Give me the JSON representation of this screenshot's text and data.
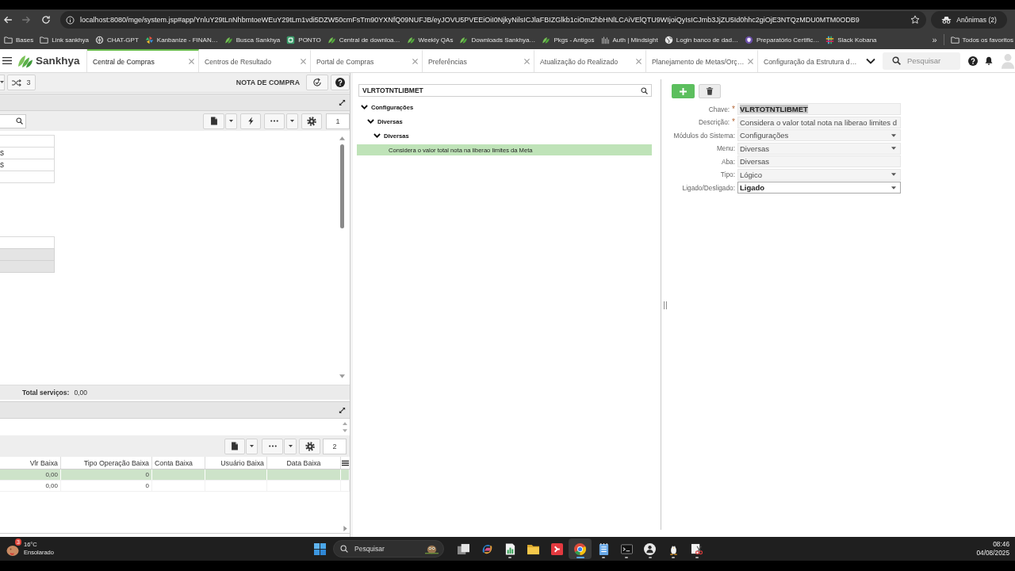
{
  "browser": {
    "back": {
      "disabled": false
    },
    "forward": {
      "disabled": true
    },
    "url": "localhost:8080/mge/system.jsp#app/YnluY29tLnNhbmtoeWEuY29tLm1vdi5DZW50cmFsTm90YXNfQ09NUFJB/eyJOVU5PVEEiOiI0NjkyNilsICJlaFBIZGlkb1ciOmZhbHNlLCAiVElQTU9WIjoiQyIsICJmb3JjZU5Id0hhc2giOjE3NTQzMDU0MTM0ODB9",
    "profile": "Anônimas (2)"
  },
  "bookmarks": {
    "items": [
      {
        "label": "Bases",
        "kind": "folder"
      },
      {
        "label": "Link sankhya",
        "kind": "folder"
      },
      {
        "label": "CHAT-GPT",
        "kind": "chat"
      },
      {
        "label": "Kanbanize - FINAN…",
        "kind": "kanban"
      },
      {
        "label": "Busca Sankhya",
        "kind": "leaf"
      },
      {
        "label": "PONTO",
        "kind": "ponto"
      },
      {
        "label": "Central de downloa…",
        "kind": "leaf"
      },
      {
        "label": "Weekly QAs",
        "kind": "leaf"
      },
      {
        "label": "Downloads Sankhya…",
        "kind": "leaf"
      },
      {
        "label": "Pkgs - Antigos",
        "kind": "leaf"
      },
      {
        "label": "Auth | Mindsight",
        "kind": "bars"
      },
      {
        "label": "Login banco de dad…",
        "kind": "globe"
      },
      {
        "label": "Preparatório Certific…",
        "kind": "cert"
      },
      {
        "label": "Slack Kobana",
        "kind": "slack"
      }
    ],
    "overflow": "»",
    "all_folder": "Todos os favoritos"
  },
  "app": {
    "brand": "Sankhya",
    "tabs": [
      {
        "label": "Central de Compras",
        "selected": true,
        "closable": true
      },
      {
        "label": "Centros de Resultado",
        "selected": false,
        "closable": true
      },
      {
        "label": "Portal de Compras",
        "selected": false,
        "closable": true
      },
      {
        "label": "Preferências",
        "selected": false,
        "closable": true
      },
      {
        "label": "Atualização do Realizado",
        "selected": false,
        "closable": true
      },
      {
        "label": "Planejamento de Metas/Orç…",
        "selected": false,
        "closable": true
      },
      {
        "label": "Configuração da Estrutura d…",
        "selected": false,
        "closable": false
      }
    ],
    "search": {
      "placeholder": "Pesquisar"
    }
  },
  "left_panel": {
    "toolbar": {
      "count": "3",
      "title": "NOTA DE COMPRA"
    },
    "grid_toolbar": {
      "page": "1"
    },
    "fields_top": [
      {
        "disabled": false
      },
      {
        "value": "s",
        "disabled": false
      },
      {
        "value": "s",
        "disabled": false
      },
      {
        "disabled": false
      }
    ],
    "fields_bottom": [
      {
        "disabled": false
      },
      {
        "disabled": true
      },
      {
        "disabled": true
      }
    ],
    "total": {
      "label": "Total serviços:",
      "value": "0,00"
    },
    "detail_toolbar": {
      "page": "2"
    },
    "table": {
      "columns": [
        "Vlr Baixa",
        "Tipo Operação Baixa",
        "Conta Baixa",
        "Usuário Baixa",
        "Data Baixa"
      ],
      "rows": [
        {
          "vlr_baixa": "0,00",
          "tipo_operacao_baixa": "0",
          "selected": true
        },
        {
          "vlr_baixa": "0,00",
          "tipo_operacao_baixa": "0",
          "selected": false
        }
      ]
    }
  },
  "middle_panel": {
    "search": {
      "value": "VLRTOTNTLIBMET"
    },
    "tree": [
      {
        "label": "Configurações",
        "expanded": true,
        "selected": false,
        "children": [
          {
            "label": "Diversas",
            "expanded": true,
            "selected": false,
            "children": [
              {
                "label": "Diversas",
                "expanded": true,
                "selected": false,
                "children": [
                  {
                    "label": "Considera o valor total nota na liberao limites da Meta",
                    "selected": true
                  }
                ]
              }
            ]
          }
        ]
      }
    ]
  },
  "right_panel": {
    "fields": [
      {
        "label": "Chave:",
        "required_mark": "*",
        "value": "VLRTOTNTLIBMET",
        "kind": "text",
        "disabled": true,
        "text_selected": true
      },
      {
        "label": "Descrição:",
        "required_mark": "*",
        "value": "Considera o valor total nota na liberao limites d",
        "kind": "text",
        "disabled": true,
        "text_selected": false
      },
      {
        "label": "Módulos do Sistema:",
        "value": "Configurações",
        "kind": "select",
        "disabled": true,
        "text_selected": false
      },
      {
        "label": "Menu:",
        "value": "Diversas",
        "kind": "select",
        "disabled": true,
        "text_selected": false
      },
      {
        "label": "Aba:",
        "value": "Diversas",
        "kind": "text",
        "disabled": true,
        "text_selected": false
      },
      {
        "label": "Tipo:",
        "value": "Lógico",
        "kind": "select",
        "disabled": true,
        "text_selected": false
      },
      {
        "label": "Ligado/Desligado:",
        "value": "Ligado",
        "kind": "select",
        "disabled": false,
        "text_selected": false
      }
    ]
  },
  "taskbar": {
    "weather": {
      "badge": "3",
      "temperature": "16°C",
      "condition": "Ensolarado"
    },
    "search": {
      "placeholder": "Pesquisar"
    },
    "apps": [
      {
        "kind": "taskview",
        "running": false,
        "active": false
      },
      {
        "kind": "swirl",
        "running": false,
        "active": false
      },
      {
        "kind": "sheet",
        "running": true,
        "active": false
      },
      {
        "kind": "folder",
        "running": false,
        "active": false
      },
      {
        "kind": "arrow",
        "running": false,
        "active": false
      },
      {
        "kind": "browser",
        "running": true,
        "active": true
      },
      {
        "kind": "notepad",
        "running": true,
        "active": false
      },
      {
        "kind": "terminal",
        "running": true,
        "active": false
      },
      {
        "kind": "face",
        "running": true,
        "active": false
      },
      {
        "kind": "penguin",
        "running": true,
        "active": false
      },
      {
        "kind": "snip",
        "running": true,
        "active": false
      }
    ],
    "clock": {
      "time": "08:46",
      "date": "04/08/2025"
    }
  }
}
